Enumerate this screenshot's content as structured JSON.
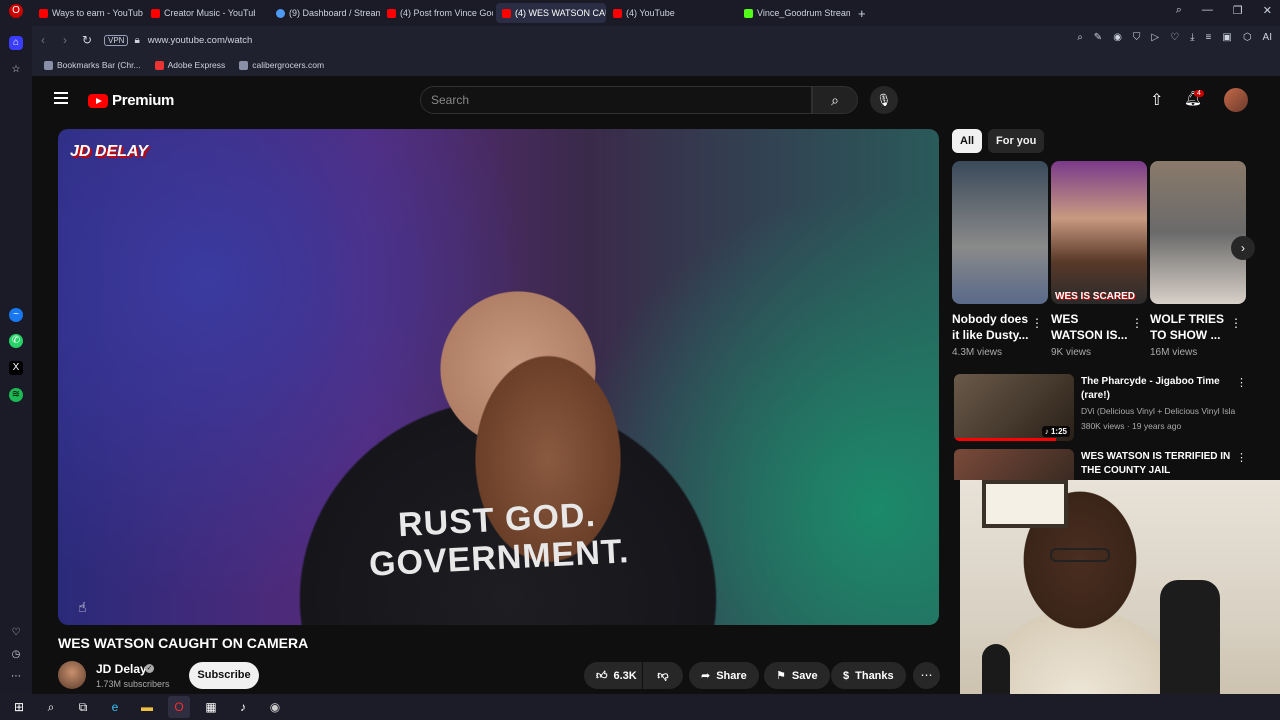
{
  "browser": {
    "tabs": [
      {
        "title": "Ways to earn - YouTube St",
        "icon": "youtube-icon"
      },
      {
        "title": "Creator Music - YouTube S",
        "icon": "youtube-icon"
      },
      {
        "title": "(9) Dashboard / Streamlab",
        "icon": "streamlabs-icon"
      },
      {
        "title": "(4) Post from Vince Good",
        "icon": "youtube-icon"
      },
      {
        "title": "(4) WES WATSON CAUGH",
        "icon": "youtube-icon"
      },
      {
        "title": "(4) YouTube",
        "icon": "youtube-icon"
      },
      {
        "title": "Vince_Goodrum Stream -",
        "icon": "kick-icon"
      }
    ],
    "new_tab": "+",
    "vpn_label": "VPN",
    "url": "www.youtube.com/watch",
    "ai_label": "AI",
    "bookmarks": [
      "Bookmarks Bar (Chr...",
      "Adobe Express",
      "calibergrocers.com"
    ]
  },
  "youtube": {
    "brand": "Premium",
    "search_placeholder": "Search",
    "notification_count": "4",
    "player": {
      "watermark": "JD DELAY",
      "shirt_line1": "RUST GOD.",
      "shirt_line2": "GOVERNMENT."
    },
    "video": {
      "title": "WES WATSON CAUGHT ON CAMERA",
      "channel": "JD Delay",
      "subscribers": "1.73M subscribers",
      "subscribe_label": "Subscribe",
      "likes": "6.3K",
      "share_label": "Share",
      "save_label": "Save",
      "thanks_label": "Thanks"
    },
    "chips": [
      "All",
      "For you"
    ],
    "shorts": [
      {
        "title": "Nobody does it like Dusty...",
        "views": "4.3M views"
      },
      {
        "title": "WES WATSON IS...",
        "views": "9K views",
        "overlay": "WES IS SCARED"
      },
      {
        "title": "WOLF TRIES TO SHOW ...",
        "views": "16M views"
      }
    ],
    "related": [
      {
        "title": "The Pharcyde - Jigaboo Time (rare!)",
        "channel": "DVi (Delicious Vinyl + Delicious Vinyl Isla...",
        "meta": "380K views · 19 years ago",
        "duration": "1:25",
        "progress": 0.85
      },
      {
        "title": "WES WATSON IS TERRIFIED IN THE COUNTY JAIL"
      }
    ]
  },
  "colors": {
    "youtube_red": "#ff0000",
    "background": "#0f0f0f",
    "chip_active": "#f1f1f1"
  }
}
